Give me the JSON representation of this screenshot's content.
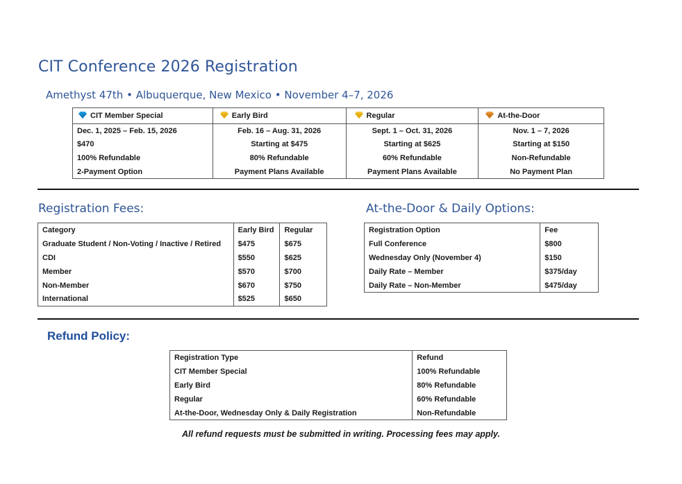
{
  "header": {
    "title": "CIT Conference 2026 Registration",
    "subtitle": "Amethyst 47th • Albuquerque, New Mexico • November 4–7, 2026"
  },
  "tiers": {
    "columns": [
      {
        "label": "CIT Member Special",
        "icon": "diamond-icon",
        "icon_color": "#1e9be0",
        "dates": "Dec. 1, 2025 – Feb. 15, 2026",
        "price": "$470",
        "refund": "100% Refundable",
        "payment": "2-Payment Option"
      },
      {
        "label": "Early Bird",
        "icon": "gem-icon",
        "icon_color": "#f2c230",
        "dates": "Feb. 16 – Aug. 31, 2026",
        "price": "Starting at $475",
        "refund": "80% Refundable",
        "payment": "Payment Plans Available"
      },
      {
        "label": "Regular",
        "icon": "gem-icon",
        "icon_color": "#f2c230",
        "dates": "Sept. 1 – Oct. 31, 2026",
        "price": "Starting at $625",
        "refund": "60% Refundable",
        "payment": "Payment Plans Available"
      },
      {
        "label": "At-the-Door",
        "icon": "gem-icon",
        "icon_color": "#e8963a",
        "dates": "Nov. 1 – 7, 2026",
        "price": "Starting at $150",
        "refund": "Non-Refundable",
        "payment": "No Payment Plan"
      }
    ]
  },
  "fees": {
    "title": "Registration Fees:",
    "headers": [
      "Category",
      "Early Bird",
      "Regular"
    ],
    "rows": [
      [
        "Graduate Student / Non-Voting / Inactive / Retired",
        "$475",
        "$675"
      ],
      [
        "CDI",
        "$550",
        "$625"
      ],
      [
        "Member",
        "$570",
        "$700"
      ],
      [
        "Non-Member",
        "$670",
        "$750"
      ],
      [
        "International",
        "$525",
        "$650"
      ]
    ]
  },
  "door": {
    "title": "At-the-Door & Daily Options:",
    "headers": [
      "Registration Option",
      "Fee"
    ],
    "rows": [
      [
        "Full Conference",
        "$800"
      ],
      [
        "Wednesday Only (November 4)",
        "$150"
      ],
      [
        "Daily Rate – Member",
        "$375/day"
      ],
      [
        "Daily Rate – Non-Member",
        "$475/day"
      ]
    ]
  },
  "refund": {
    "title": "Refund Policy:",
    "headers": [
      "Registration Type",
      "Refund"
    ],
    "rows": [
      [
        "CIT Member Special",
        "100% Refundable"
      ],
      [
        "Early Bird",
        "80% Refundable"
      ],
      [
        "Regular",
        "60% Refundable"
      ],
      [
        "At-the-Door, Wednesday Only & Daily Registration",
        "Non-Refundable"
      ]
    ],
    "note": "All refund requests must be submitted in writing. Processing fees may apply."
  }
}
